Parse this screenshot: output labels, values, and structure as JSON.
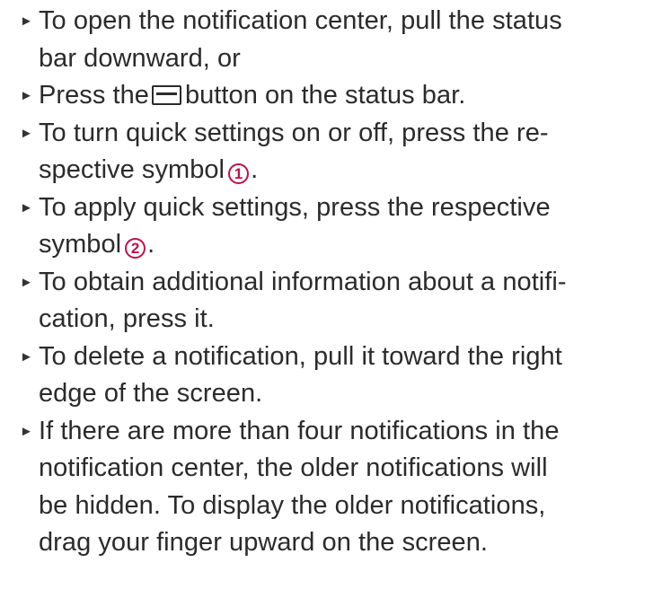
{
  "colors": {
    "text": "#2b2b2b",
    "callout": "#c0104c"
  },
  "bullet_glyph": "►",
  "steps": [
    {
      "line1": "To open the notification center, pull the status",
      "line2": "bar downward, or"
    },
    {
      "before_icon": "Press the",
      "icon": "menu-button-icon",
      "after_icon": "button on the status bar."
    },
    {
      "line1": "To turn quick settings on or off, press the re-",
      "line2_before": "spective symbol",
      "callout": "1",
      "line2_after": "."
    },
    {
      "line1": "To apply quick settings, press the respective",
      "line2_before": "symbol",
      "callout": "2",
      "line2_after": "."
    },
    {
      "line1": "To obtain additional information about a notifi-",
      "line2": "cation, press it."
    },
    {
      "line1": "To delete a notification, pull it toward the right",
      "line2": "edge of the screen."
    },
    {
      "line1": "If there are more than four notifications in the",
      "line2": "notification center, the older notifications will",
      "line3": "be hidden. To display the older notifications,",
      "line4": "drag your finger upward on the screen."
    }
  ]
}
